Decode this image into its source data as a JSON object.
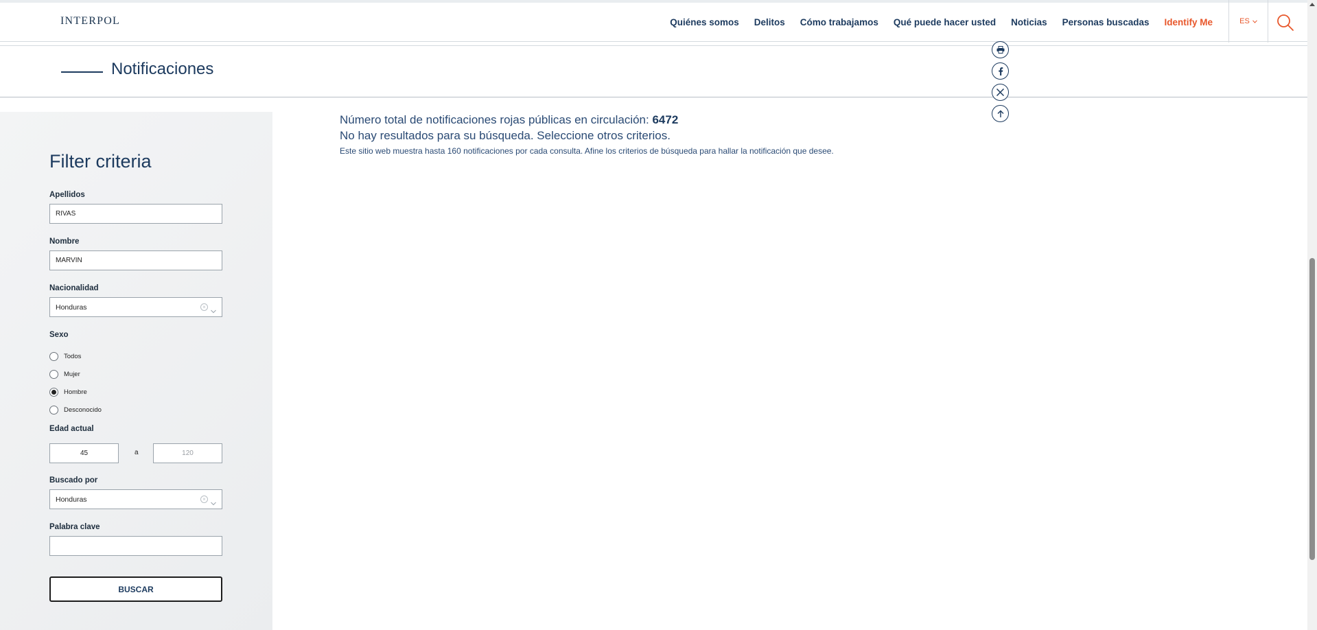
{
  "header": {
    "logo": "INTERPOL",
    "nav": [
      {
        "label": "Quiénes somos",
        "name": "nav-quienes-somos"
      },
      {
        "label": "Delitos",
        "name": "nav-delitos"
      },
      {
        "label": "Cómo trabajamos",
        "name": "nav-como-trabajamos"
      },
      {
        "label": "Qué puede hacer usted",
        "name": "nav-que-puede-hacer-usted"
      },
      {
        "label": "Noticias",
        "name": "nav-noticias"
      },
      {
        "label": "Personas buscadas",
        "name": "nav-personas-buscadas"
      },
      {
        "label": "Identify Me",
        "name": "nav-identify-me"
      }
    ],
    "language": "ES",
    "accent_color": "#e8572b",
    "nav_color": "#1c3a5e"
  },
  "page": {
    "title": "Notificaciones"
  },
  "share": {
    "icons": [
      "print-icon",
      "facebook-icon",
      "x-icon",
      "back-to-top-icon"
    ]
  },
  "filter": {
    "title": "Filter criteria",
    "surname": {
      "label": "Apellidos",
      "value": "RIVAS"
    },
    "forename": {
      "label": "Nombre",
      "value": "MARVIN"
    },
    "nationality": {
      "label": "Nacionalidad",
      "value": "Honduras"
    },
    "sex": {
      "label": "Sexo",
      "options": [
        "Todos",
        "Mujer",
        "Hombre",
        "Desconocido"
      ],
      "selected": "Hombre"
    },
    "age": {
      "label": "Edad actual",
      "from": "45",
      "separator": "a",
      "to_placeholder": "120"
    },
    "wanted_by": {
      "label": "Buscado por",
      "value": "Honduras"
    },
    "keyword": {
      "label": "Palabra clave",
      "value": ""
    },
    "submit_label": "BUSCAR"
  },
  "results": {
    "total_prefix": "Número total de notificaciones rojas públicas en circulación:",
    "total_count": "6472",
    "no_results": "No hay resultados para su búsqueda. Seleccione otros criterios.",
    "limit_note": "Este sitio web muestra hasta 160 notificaciones por cada consulta. Afine los criterios de búsqueda para hallar la notificación que desee."
  }
}
